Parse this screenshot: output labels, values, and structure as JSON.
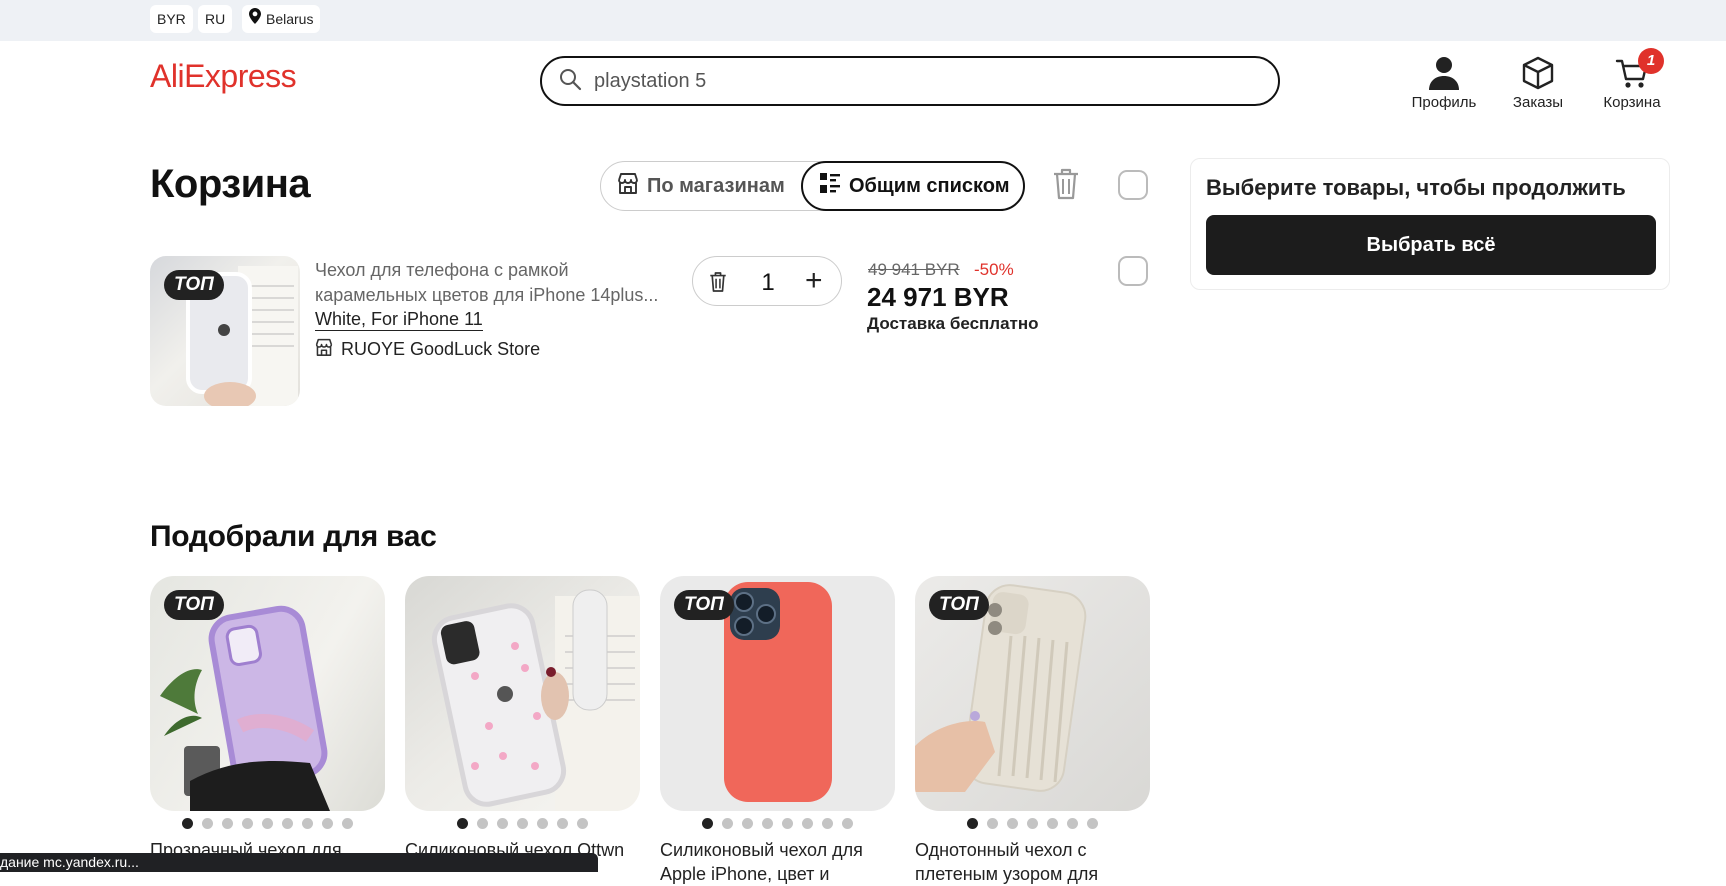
{
  "topbar": {
    "currency": "BYR",
    "language": "RU",
    "region": "Belarus"
  },
  "header": {
    "logo": "AliExpress",
    "search_value": "playstation 5",
    "profile_label": "Профиль",
    "orders_label": "Заказы",
    "cart_label": "Корзина",
    "cart_count": "1"
  },
  "cart": {
    "title": "Корзина",
    "view_by_store": "По магазинам",
    "view_list": "Общим списком",
    "items": [
      {
        "badge": "ТОП",
        "title": "Чехол для телефона с рамкой карамельных цветов для iPhone 14plus...",
        "variant": "White, For iPhone 11",
        "store": "RUOYE GoodLuck Store",
        "quantity": "1",
        "old_price": "49 941 BYR",
        "discount": "-50%",
        "price": "24 971 BYR",
        "delivery": "Доставка бесплатно"
      }
    ]
  },
  "summary": {
    "title": "Выберите товары, чтобы продолжить",
    "button": "Выбрать всё"
  },
  "recommend": {
    "title": "Подобрали для вас",
    "cards": [
      {
        "badge": "ТОП",
        "title": "Прозрачный чехол для",
        "dots": 9
      },
      {
        "badge": "",
        "title": "Силиконовый чехол Ottwn",
        "dots": 7
      },
      {
        "badge": "ТОП",
        "title": "Силиконовый чехол для Apple iPhone, цвет и",
        "dots": 8
      },
      {
        "badge": "ТОП",
        "title": "Однотонный чехол с плетеным узором для",
        "dots": 7
      }
    ]
  },
  "status_bar": "дание mc.yandex.ru...",
  "colors": {
    "accent": "#e0322b",
    "dark": "#1c1c1c"
  }
}
